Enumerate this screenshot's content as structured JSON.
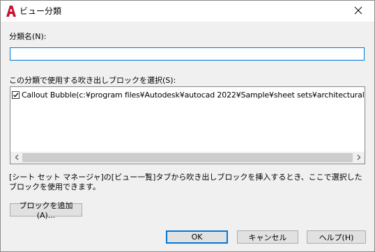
{
  "window": {
    "title": "ビュー分類",
    "app_icon": "autocad-a-icon",
    "close_icon": "close-icon"
  },
  "name_field": {
    "label": "分類名(N):",
    "value": ""
  },
  "callout_list": {
    "label": "この分類で使用する吹き出しブロックを選択(S):",
    "items": [
      {
        "checked": true,
        "text": "Callout Bubble(c:¥program files¥Autodesk¥autocad 2022¥Sample¥sheet sets¥architectural¥IRD.dwt)"
      }
    ]
  },
  "help_text": "[シート セット マネージャ]の[ビュー一覧]タブから吹き出しブロックを挿入するとき、ここで選択したブロックを使用できます。",
  "buttons": {
    "add_block": "ブロックを追加(A)...",
    "ok": "OK",
    "cancel": "キャンセル",
    "help": "ヘルプ(H)"
  },
  "colors": {
    "accent": "#0078d7",
    "app_icon": "#c8102e",
    "dialog_bg": "#f0f0f0"
  }
}
